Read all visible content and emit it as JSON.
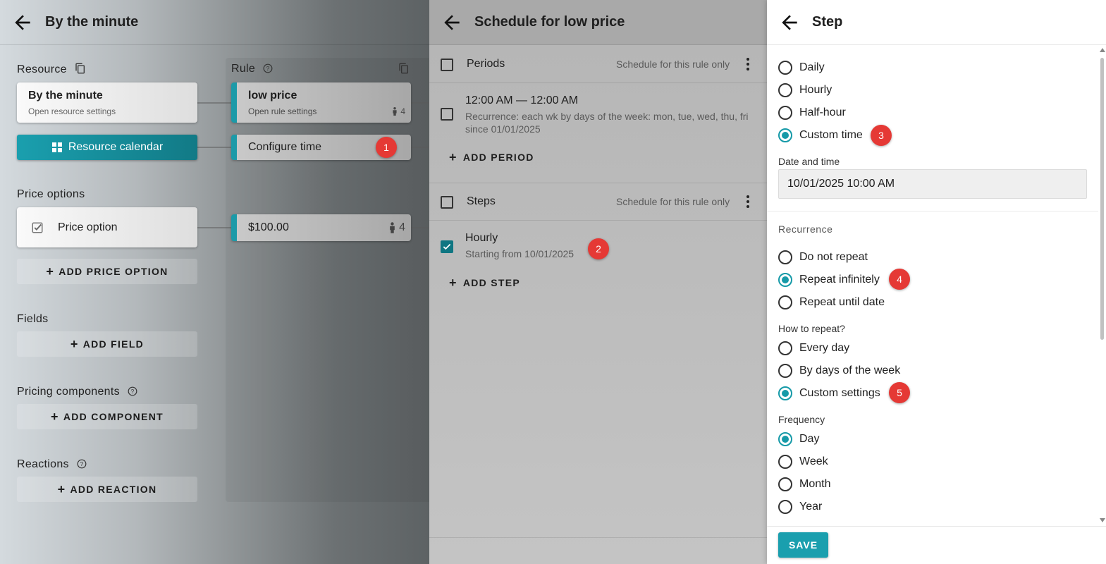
{
  "panel1": {
    "title": "By the minute",
    "resource_label": "Resource",
    "resource_card": {
      "name": "By the minute",
      "sub": "Open resource settings"
    },
    "calendar_button": "Resource calendar",
    "rule_label": "Rule",
    "rule_card": {
      "name": "low price",
      "sub": "Open rule settings",
      "count": "4"
    },
    "configure_time": "Configure time",
    "price_options_label": "Price options",
    "price_option_card": "Price option",
    "price_value": "$100.00",
    "price_count": "4",
    "add_price_option": "ADD PRICE OPTION",
    "fields_label": "Fields",
    "add_field": "ADD FIELD",
    "pricing_components_label": "Pricing components",
    "add_component": "ADD COMPONENT",
    "reactions_label": "Reactions",
    "add_reaction": "ADD REACTION"
  },
  "panel2": {
    "title": "Schedule for low price",
    "periods_label": "Periods",
    "periods_note": "Schedule for this rule only",
    "period_item": {
      "time": "12:00 AM — 12:00 AM",
      "recurrence": "Recurrence: each wk by days of the week: mon, tue, wed, thu, fri",
      "since": "since 01/01/2025"
    },
    "add_period": "ADD PERIOD",
    "steps_label": "Steps",
    "steps_note": "Schedule for this rule only",
    "step_item": {
      "name": "Hourly",
      "start": "Starting from 10/01/2025"
    },
    "add_step": "ADD STEP"
  },
  "panel3": {
    "title": "Step",
    "type_options": [
      "Daily",
      "Hourly",
      "Half-hour",
      "Custom time"
    ],
    "type_selected": "Custom time",
    "date_time_label": "Date and time",
    "date_time_value": "10/01/2025 10:00 AM",
    "recurrence_label": "Recurrence",
    "recurrence_options": [
      "Do not repeat",
      "Repeat infinitely",
      "Repeat until date"
    ],
    "recurrence_selected": "Repeat infinitely",
    "how_label": "How to repeat?",
    "how_options": [
      "Every day",
      "By days of the week",
      "Custom settings"
    ],
    "how_selected": "Custom settings",
    "frequency_label": "Frequency",
    "frequency_options": [
      "Day",
      "Week",
      "Month",
      "Year"
    ],
    "frequency_selected": "Day",
    "save": "SAVE"
  },
  "markers": [
    "1",
    "2",
    "3",
    "4",
    "5"
  ],
  "colors": {
    "accent": "#1a9fae",
    "marker": "#e53935"
  }
}
